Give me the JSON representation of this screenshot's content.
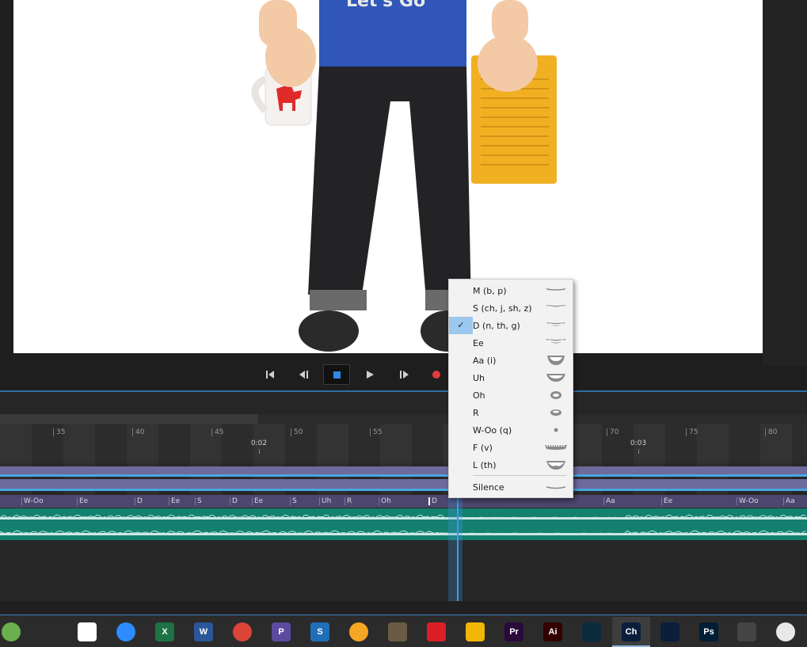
{
  "transport": {
    "buttons": [
      "go-to-start",
      "previous-frame",
      "stop",
      "play",
      "next-frame",
      "record"
    ]
  },
  "timeline": {
    "frame_ticks": [
      "35",
      "40",
      "45",
      "50",
      "55",
      "70",
      "75",
      "80"
    ],
    "seconds": [
      "0:02",
      "0:03"
    ],
    "visemes": [
      "W-Oo",
      "Ee",
      "D",
      "Ee",
      "S",
      "D",
      "Ee",
      "S",
      "Uh",
      "R",
      "Oh",
      "D",
      "Aa",
      "Ee",
      "W-Oo",
      "Aa"
    ]
  },
  "menu": {
    "items": [
      {
        "label": "M (b, p)",
        "selected": false
      },
      {
        "label": "S (ch, j, sh, z)",
        "selected": false
      },
      {
        "label": "D (n, th, g)",
        "selected": true
      },
      {
        "label": "Ee",
        "selected": false
      },
      {
        "label": "Aa (i)",
        "selected": false
      },
      {
        "label": "Uh",
        "selected": false
      },
      {
        "label": "Oh",
        "selected": false
      },
      {
        "label": "R",
        "selected": false
      },
      {
        "label": "W-Oo (q)",
        "selected": false
      },
      {
        "label": "F (v)",
        "selected": false
      },
      {
        "label": "L (th)",
        "selected": false
      }
    ],
    "silence_label": "Silence",
    "check_glyph": "✓"
  },
  "taskbar": {
    "apps": [
      {
        "icon": "android-studio-icon",
        "text": "",
        "color": "#6ab04c"
      },
      {
        "icon": "cascadeur-icon",
        "text": "",
        "color": "#2b2b2b"
      },
      {
        "icon": "slack-icon",
        "text": "",
        "color": "#ffffff"
      },
      {
        "icon": "zoom-icon",
        "text": "",
        "color": "#2d8cff"
      },
      {
        "icon": "excel-icon",
        "text": "X",
        "color": "#1f7244"
      },
      {
        "icon": "word-icon",
        "text": "W",
        "color": "#2b579a"
      },
      {
        "icon": "chrome-icon",
        "text": "",
        "color": "#db4437"
      },
      {
        "icon": "p-app-icon",
        "text": "P",
        "color": "#5b4aa0"
      },
      {
        "icon": "snagit-icon",
        "text": "S",
        "color": "#1e6fb8"
      },
      {
        "icon": "yellow-circle-icon",
        "text": "",
        "color": "#f5a623"
      },
      {
        "icon": "gimp-icon",
        "text": "",
        "color": "#6b5b45"
      },
      {
        "icon": "creative-cloud-icon",
        "text": "",
        "color": "#da1f26"
      },
      {
        "icon": "grid-app-icon",
        "text": "",
        "color": "#f2b705"
      },
      {
        "icon": "premiere-icon",
        "text": "Pr",
        "color": "#2a0a3a"
      },
      {
        "icon": "illustrator-icon",
        "text": "Ai",
        "color": "#330000"
      },
      {
        "icon": "character-animator-butterfly-icon",
        "text": "",
        "color": "#0d2a3a"
      },
      {
        "icon": "character-animator-icon",
        "text": "Ch",
        "color": "#0a1e3c"
      },
      {
        "icon": "media-encoder-icon",
        "text": "",
        "color": "#0b1e3a"
      },
      {
        "icon": "photoshop-icon",
        "text": "Ps",
        "color": "#001e36"
      },
      {
        "icon": "wifi-app-icon",
        "text": "",
        "color": "#444"
      },
      {
        "icon": "clock-icon",
        "text": "",
        "color": "#e8e8e8"
      }
    ]
  }
}
